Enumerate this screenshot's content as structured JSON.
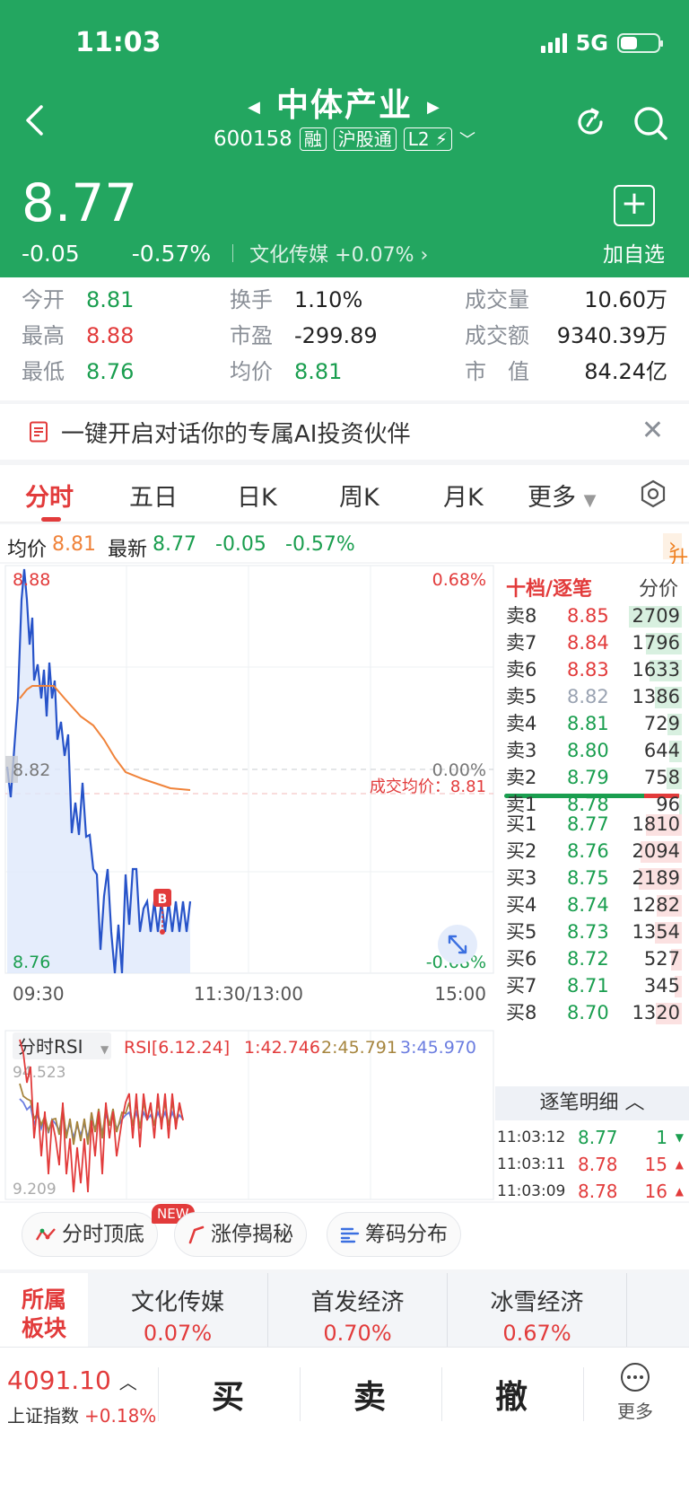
{
  "status": {
    "time": "11:03",
    "network": "5G"
  },
  "header": {
    "name": "中体产业",
    "code": "600158",
    "tags": [
      "融",
      "沪股通",
      "L2"
    ],
    "price": "8.77",
    "change": "-0.05",
    "change_pct": "-0.57%",
    "sector": "文化传媒",
    "sector_pct": "+0.07%",
    "add_label": "加自选"
  },
  "stats": [
    {
      "k": "今开",
      "v": "8.81",
      "c": "green"
    },
    {
      "k": "最高",
      "v": "8.88",
      "c": "red"
    },
    {
      "k": "最低",
      "v": "8.76",
      "c": "green"
    },
    {
      "k": "换手",
      "v": "1.10%",
      "c": ""
    },
    {
      "k": "市盈",
      "v": "-299.89",
      "c": ""
    },
    {
      "k": "均价",
      "v": "8.81",
      "c": "green"
    },
    {
      "k": "成交量",
      "v": "10.60万",
      "c": ""
    },
    {
      "k": "成交额",
      "v": "9340.39万",
      "c": ""
    },
    {
      "k": "市　值",
      "v": "84.24亿",
      "c": ""
    }
  ],
  "ai_banner": "一键开启对话你的专属AI投资伙伴",
  "tabs": [
    "分时",
    "五日",
    "日K",
    "周K",
    "月K",
    "更多"
  ],
  "info": {
    "avg_label": "均价",
    "avg": "8.81",
    "last_label": "最新",
    "last": "8.77",
    "chg": "-0.05",
    "pct": "-0.57%",
    "upsell": "升级盘中实时信号"
  },
  "chart": {
    "y_top": "8.88",
    "y_mid": "8.82",
    "y_bot": "8.76",
    "pct_top": "0.68%",
    "pct_mid": "0.00%",
    "pct_bot": "-0.68%",
    "avg_note": "成交均价：8.81",
    "x_labels": [
      "09:30",
      "11:30/13:00",
      "15:00"
    ],
    "b_marker": "B",
    "rsi_title": "分时RSI",
    "rsi_params": "RSI[6.12.24]",
    "rsi1": "1:42.746",
    "rsi2": "2:45.791",
    "rsi3": "3:45.970",
    "rsi_top": "94.523",
    "rsi_bot": "9.209",
    "colors": {
      "price": "#2753c9",
      "avg": "#f0833a",
      "rsi1": "#e23b3b",
      "rsi2": "#a6853e",
      "rsi3": "#6b7de0"
    }
  },
  "orderbook": {
    "title": "十档/逐笔",
    "fp": "分价",
    "sells": [
      {
        "l": "卖8",
        "p": "8.85",
        "v": "2709",
        "c": "red",
        "r": 0.9
      },
      {
        "l": "卖7",
        "p": "8.84",
        "v": "1796",
        "c": "red",
        "r": 0.6
      },
      {
        "l": "卖6",
        "p": "8.83",
        "v": "1633",
        "c": "red",
        "r": 0.54
      },
      {
        "l": "卖5",
        "p": "8.82",
        "v": "1386",
        "c": "gray",
        "r": 0.46
      },
      {
        "l": "卖4",
        "p": "8.81",
        "v": "729",
        "c": "green",
        "r": 0.24
      },
      {
        "l": "卖3",
        "p": "8.80",
        "v": "644",
        "c": "green",
        "r": 0.21
      },
      {
        "l": "卖2",
        "p": "8.79",
        "v": "758",
        "c": "green",
        "r": 0.25
      },
      {
        "l": "卖1",
        "p": "8.78",
        "v": "96",
        "c": "green",
        "r": 0.04
      }
    ],
    "buys": [
      {
        "l": "买1",
        "p": "8.77",
        "v": "1810",
        "c": "green",
        "r": 0.6
      },
      {
        "l": "买2",
        "p": "8.76",
        "v": "2094",
        "c": "green",
        "r": 0.7
      },
      {
        "l": "买3",
        "p": "8.75",
        "v": "2189",
        "c": "green",
        "r": 0.73
      },
      {
        "l": "买4",
        "p": "8.74",
        "v": "1282",
        "c": "green",
        "r": 0.43
      },
      {
        "l": "买5",
        "p": "8.73",
        "v": "1354",
        "c": "green",
        "r": 0.45
      },
      {
        "l": "买6",
        "p": "8.72",
        "v": "527",
        "c": "green",
        "r": 0.18
      },
      {
        "l": "买7",
        "p": "8.71",
        "v": "345",
        "c": "green",
        "r": 0.12
      },
      {
        "l": "买8",
        "p": "8.70",
        "v": "1320",
        "c": "green",
        "r": 0.44
      }
    ],
    "ticks_title": "逐笔明细",
    "ticks": [
      {
        "t": "11:03:12",
        "p": "8.77",
        "v": "1",
        "c": "green"
      },
      {
        "t": "11:03:11",
        "p": "8.78",
        "v": "15",
        "c": "red"
      },
      {
        "t": "11:03:09",
        "p": "8.78",
        "v": "16",
        "c": "red"
      }
    ]
  },
  "tools": [
    "分时顶底",
    "涨停揭秘",
    "筹码分布"
  ],
  "new_badge": "NEW",
  "sectors": {
    "label": "所属板块",
    "items": [
      {
        "n": "文化传媒",
        "p": "0.07%"
      },
      {
        "n": "首发经济",
        "p": "0.70%"
      },
      {
        "n": "冰雪经济",
        "p": "0.67%"
      }
    ]
  },
  "bottom": {
    "index_value": "4091.10",
    "index_name": "上证指数",
    "index_pct": "+0.18%",
    "buy": "买",
    "sell": "卖",
    "cancel": "撤",
    "more": "更多"
  }
}
